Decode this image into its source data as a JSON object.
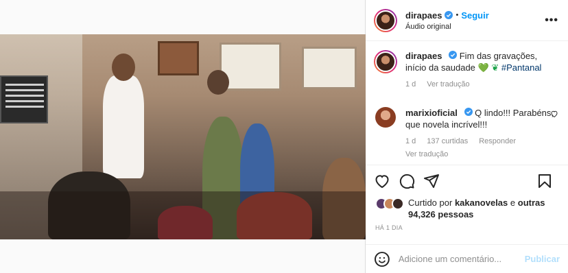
{
  "header": {
    "username": "dirapaes",
    "separator": "•",
    "follow_label": "Seguir",
    "audio_label": "Áudio original",
    "more_label": "•••"
  },
  "caption": {
    "username": "dirapaes",
    "text": "Fim das gravações, início da saudade",
    "emoji": "💚",
    "hashtag": "#Pantanal",
    "age": "1 d",
    "translate": "Ver tradução"
  },
  "comment": {
    "username": "marixioficial",
    "text": "Q lindo!!! Parabéns, que novela incrível!!!",
    "age": "1 d",
    "likes": "137 curtidas",
    "reply": "Responder",
    "translate": "Ver tradução"
  },
  "likes": {
    "prefix": "Curtido por",
    "user": "kakanovelas",
    "middle": "e",
    "others": "outras 94,326 pessoas"
  },
  "timestamp": "HÁ 1 DIA",
  "add_comment": {
    "placeholder": "Adicione um comentário...",
    "publish_label": "Publicar"
  },
  "colors": {
    "accent": "#0095f6",
    "publish_disabled": "#b2dffc",
    "muted_text": "#8e8e8e"
  },
  "icons": [
    "verified-badge-icon",
    "more-options-icon",
    "heart-icon",
    "comment-icon",
    "share-icon",
    "save-icon",
    "emoji-icon",
    "mute-icon",
    "tagged-user-icon"
  ]
}
